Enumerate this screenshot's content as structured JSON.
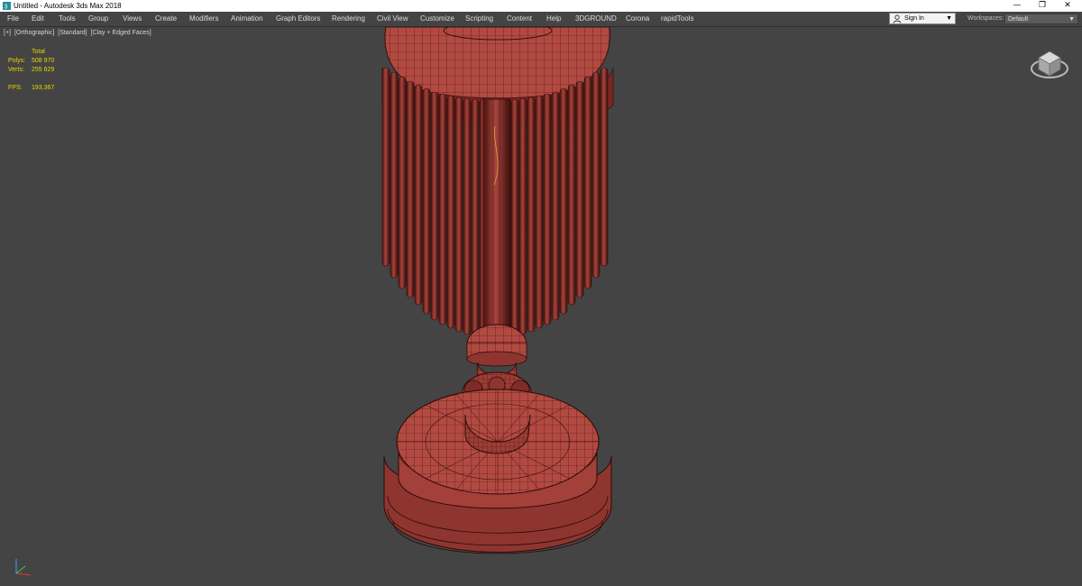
{
  "window": {
    "title": "Untitled - Autodesk 3ds Max 2018",
    "controls": {
      "minimize": "—",
      "maximize": "❐",
      "close": "✕"
    }
  },
  "menu": {
    "items": [
      "File",
      "Edit",
      "Tools",
      "Group",
      "Views",
      "Create",
      "Modifiers",
      "Animation",
      "Graph Editors",
      "Rendering",
      "Civil View",
      "Customize",
      "Scripting",
      "Content",
      "Help",
      "3DGROUND",
      "Corona",
      "rapidTools"
    ]
  },
  "account": {
    "signin_label": "Sign In"
  },
  "workspaces": {
    "label": "Workspaces:",
    "value": "Default"
  },
  "viewport": {
    "label_parts": [
      "[+]",
      "[Orthographic]",
      "[Standard]",
      "[Clay + Edged Faces]"
    ],
    "stats": {
      "heading": "Total",
      "polys_label": "Polys:",
      "polys_value": "508 970",
      "verts_label": "Verts:",
      "verts_value": "255 629",
      "fps_label": "FPS:",
      "fps_value": "193,367"
    }
  },
  "colors": {
    "viewport_bg": "#444444",
    "model_fill": "#b24a42",
    "model_edges": "#3a0f0c",
    "stats_text": "#e9d600"
  },
  "icons": {
    "app": "3ds-max-icon",
    "user": "user-icon",
    "viewcube": "viewcube-icon",
    "axis": "axis-tripod-icon"
  }
}
